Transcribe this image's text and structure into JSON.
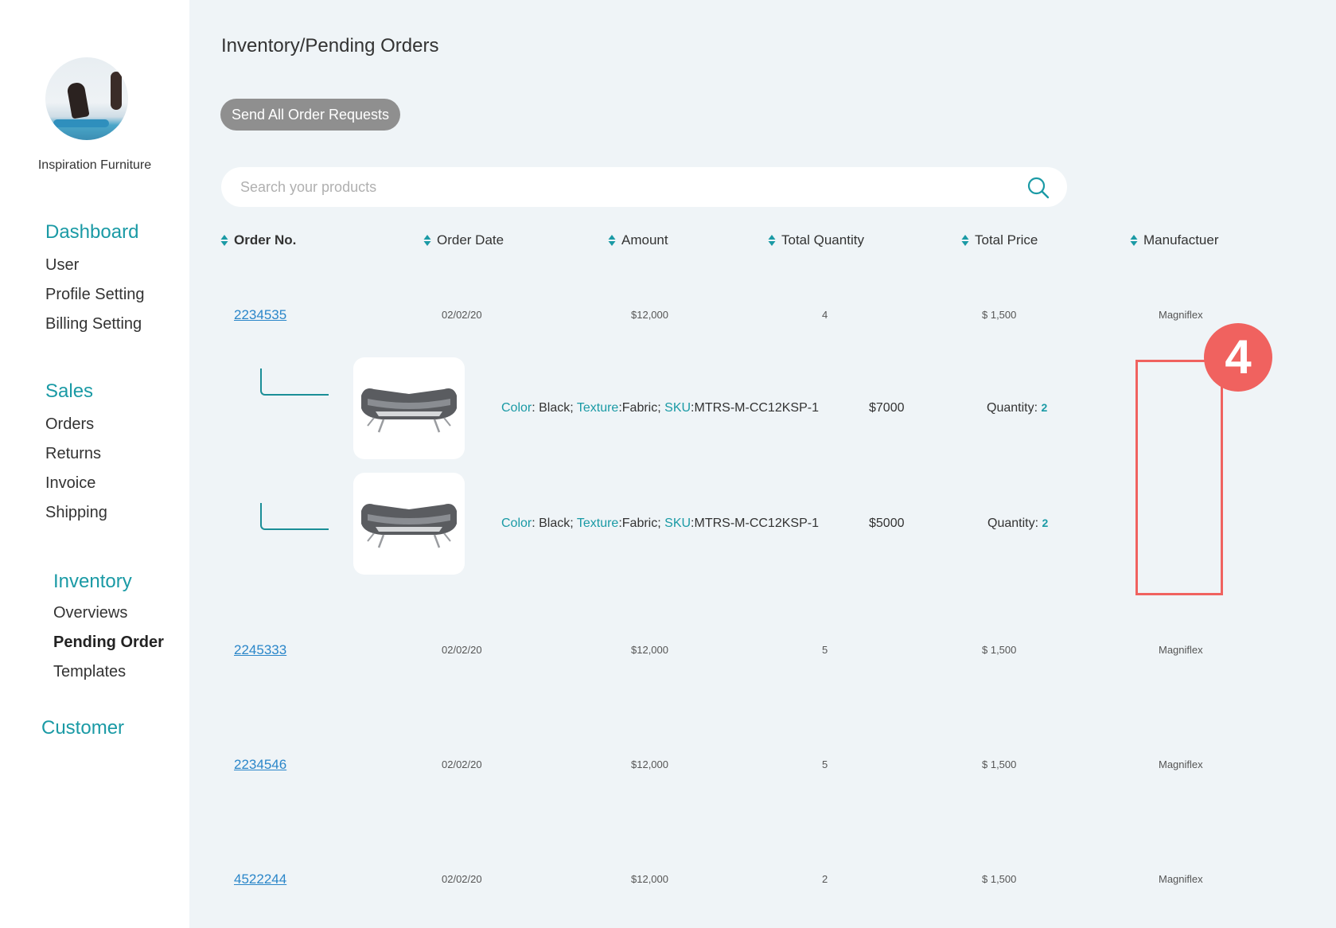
{
  "sidebar": {
    "brand_name": "Inspiration Furniture",
    "sections": [
      {
        "label": "Dashboard",
        "items": [
          "User",
          "Profile Setting",
          "Billing Setting"
        ]
      },
      {
        "label": "Sales",
        "items": [
          "Orders",
          "Returns",
          "Invoice",
          "Shipping"
        ]
      },
      {
        "label": "Inventory",
        "items": [
          "Overviews",
          "Pending Order",
          "Templates"
        ],
        "active": "Pending Order"
      },
      {
        "label": "Customer",
        "items": []
      }
    ]
  },
  "header": {
    "title": "Inventory/Pending Orders",
    "send_button": "Send All Order Requests"
  },
  "search": {
    "placeholder": "Search your products",
    "value": ""
  },
  "table": {
    "columns": [
      "Order No.",
      "Order Date",
      "Amount",
      "Total Quantity",
      "Total Price",
      "Manufactuer"
    ],
    "rows": [
      {
        "order_no": "2234535",
        "date": "02/02/20",
        "amount": "$12,000",
        "total_qty": "4",
        "total_price": "$ 1,500",
        "manufacturer": "Magniflex"
      },
      {
        "order_no": "2245333",
        "date": "02/02/20",
        "amount": "$12,000",
        "total_qty": "5",
        "total_price": "$ 1,500",
        "manufacturer": "Magniflex"
      },
      {
        "order_no": "2234546",
        "date": "02/02/20",
        "amount": "$12,000",
        "total_qty": "5",
        "total_price": "$ 1,500",
        "manufacturer": "Magniflex"
      },
      {
        "order_no": "4522244",
        "date": "02/02/20",
        "amount": "$12,000",
        "total_qty": "2",
        "total_price": "$ 1,500",
        "manufacturer": "Magniflex"
      }
    ],
    "sub_items": [
      {
        "color_key": "Color",
        "color_val": "Black;",
        "texture_key": "Texture",
        "texture_val": "Fabric;",
        "sku_key": "SKU",
        "sku_val": "MTRS-M-CC12KSP-1",
        "price": "$7000",
        "qty_label": "Quantity:",
        "qty": "2"
      },
      {
        "color_key": "Color",
        "color_val": "Black;",
        "texture_key": "Texture",
        "texture_val": "Fabric;",
        "sku_key": "SKU",
        "sku_val": "MTRS-M-CC12KSP-1",
        "price": "$5000",
        "qty_label": "Quantity:",
        "qty": "2"
      }
    ]
  },
  "annotation": {
    "step": "4"
  },
  "colors": {
    "accent": "#1a9aa5",
    "link": "#2a86c9",
    "highlight": "#f0625f",
    "button": "#8f8f8f"
  },
  "icons": [
    "search-icon",
    "sort-icon",
    "sofa-image"
  ]
}
